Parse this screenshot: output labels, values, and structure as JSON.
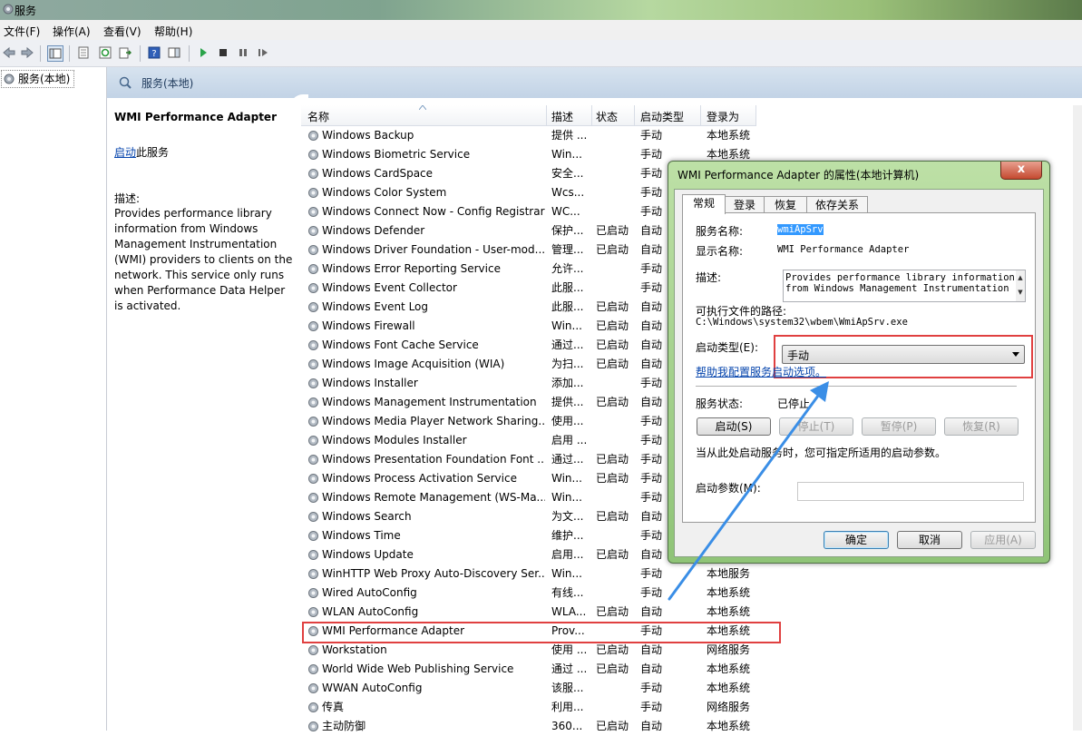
{
  "window": {
    "title": "服务"
  },
  "menu": [
    "文件(F)",
    "操作(A)",
    "查看(V)",
    "帮助(H)"
  ],
  "tree": {
    "root": "服务(本地)"
  },
  "panel_header": "服务(本地)",
  "details": {
    "service_name": "WMI Performance Adapter",
    "start_link": "启动",
    "start_suffix": "此服务",
    "desc_label": "描述:",
    "desc_text": "Provides performance library information from Windows Management Instrumentation (WMI) providers to clients on the network. This service only runs when Performance Data Helper is activated."
  },
  "columns": {
    "name": "名称",
    "desc": "描述",
    "status": "状态",
    "startup": "启动类型",
    "logon": "登录为"
  },
  "services": [
    {
      "name": "Windows Backup",
      "desc": "提供 ...",
      "status": "",
      "startup": "手动",
      "logon": "本地系统"
    },
    {
      "name": "Windows Biometric Service",
      "desc": "Win...",
      "status": "",
      "startup": "手动",
      "logon": "本地系统"
    },
    {
      "name": "Windows CardSpace",
      "desc": "安全...",
      "status": "",
      "startup": "手动",
      "logon": ""
    },
    {
      "name": "Windows Color System",
      "desc": "Wcs...",
      "status": "",
      "startup": "手动",
      "logon": ""
    },
    {
      "name": "Windows Connect Now - Config Registrar",
      "desc": "WC...",
      "status": "",
      "startup": "手动",
      "logon": ""
    },
    {
      "name": "Windows Defender",
      "desc": "保护...",
      "status": "已启动",
      "startup": "自动",
      "logon": ""
    },
    {
      "name": "Windows Driver Foundation - User-mod...",
      "desc": "管理...",
      "status": "已启动",
      "startup": "自动",
      "logon": ""
    },
    {
      "name": "Windows Error Reporting Service",
      "desc": "允许...",
      "status": "",
      "startup": "手动",
      "logon": ""
    },
    {
      "name": "Windows Event Collector",
      "desc": "此服...",
      "status": "",
      "startup": "手动",
      "logon": ""
    },
    {
      "name": "Windows Event Log",
      "desc": "此服...",
      "status": "已启动",
      "startup": "自动",
      "logon": ""
    },
    {
      "name": "Windows Firewall",
      "desc": "Win...",
      "status": "已启动",
      "startup": "自动",
      "logon": ""
    },
    {
      "name": "Windows Font Cache Service",
      "desc": "通过...",
      "status": "已启动",
      "startup": "自动",
      "logon": ""
    },
    {
      "name": "Windows Image Acquisition (WIA)",
      "desc": "为扫...",
      "status": "已启动",
      "startup": "自动",
      "logon": ""
    },
    {
      "name": "Windows Installer",
      "desc": "添加...",
      "status": "",
      "startup": "手动",
      "logon": ""
    },
    {
      "name": "Windows Management Instrumentation",
      "desc": "提供...",
      "status": "已启动",
      "startup": "自动",
      "logon": ""
    },
    {
      "name": "Windows Media Player Network Sharing...",
      "desc": "使用...",
      "status": "",
      "startup": "手动",
      "logon": ""
    },
    {
      "name": "Windows Modules Installer",
      "desc": "启用 ...",
      "status": "",
      "startup": "手动",
      "logon": ""
    },
    {
      "name": "Windows Presentation Foundation Font ...",
      "desc": "通过...",
      "status": "已启动",
      "startup": "手动",
      "logon": ""
    },
    {
      "name": "Windows Process Activation Service",
      "desc": "Win...",
      "status": "已启动",
      "startup": "手动",
      "logon": ""
    },
    {
      "name": "Windows Remote Management (WS-Ma...",
      "desc": "Win...",
      "status": "",
      "startup": "手动",
      "logon": ""
    },
    {
      "name": "Windows Search",
      "desc": "为文...",
      "status": "已启动",
      "startup": "自动",
      "logon": ""
    },
    {
      "name": "Windows Time",
      "desc": "维护...",
      "status": "",
      "startup": "手动",
      "logon": ""
    },
    {
      "name": "Windows Update",
      "desc": "启用...",
      "status": "已启动",
      "startup": "自动",
      "logon": ""
    },
    {
      "name": "WinHTTP Web Proxy Auto-Discovery Ser...",
      "desc": "Win...",
      "status": "",
      "startup": "手动",
      "logon": "本地服务"
    },
    {
      "name": "Wired AutoConfig",
      "desc": "有线...",
      "status": "",
      "startup": "手动",
      "logon": "本地系统"
    },
    {
      "name": "WLAN AutoConfig",
      "desc": "WLA...",
      "status": "已启动",
      "startup": "自动",
      "logon": "本地系统"
    },
    {
      "name": "WMI Performance Adapter",
      "desc": "Prov...",
      "status": "",
      "startup": "手动",
      "logon": "本地系统"
    },
    {
      "name": "Workstation",
      "desc": "使用 ...",
      "status": "已启动",
      "startup": "自动",
      "logon": "网络服务"
    },
    {
      "name": "World Wide Web Publishing Service",
      "desc": "通过 ...",
      "status": "已启动",
      "startup": "自动",
      "logon": "本地系统"
    },
    {
      "name": "WWAN AutoConfig",
      "desc": "该服...",
      "status": "",
      "startup": "手动",
      "logon": "本地系统"
    },
    {
      "name": "传真",
      "desc": "利用...",
      "status": "",
      "startup": "手动",
      "logon": "网络服务"
    },
    {
      "name": "主动防御",
      "desc": "360...",
      "status": "已启动",
      "startup": "自动",
      "logon": "本地系统"
    }
  ],
  "dialog": {
    "title": "WMI Performance Adapter 的属性(本地计算机)",
    "close": "x",
    "tabs": [
      "常规",
      "登录",
      "恢复",
      "依存关系"
    ],
    "svc_name_label": "服务名称:",
    "svc_name_value": "wmiApSrv",
    "display_name_label": "显示名称:",
    "display_name_value": "WMI Performance Adapter",
    "desc_label": "描述:",
    "desc_value_1": "Provides performance library information",
    "desc_value_2": "from Windows Management Instrumentation",
    "path_label": "可执行文件的路径:",
    "path_value": "C:\\Windows\\system32\\wbem\\WmiApSrv.exe",
    "startup_label": "启动类型(E):",
    "startup_value": "手动",
    "help_link": "帮助我配置服务启动选项。",
    "status_label": "服务状态:",
    "status_value": "已停止",
    "btn_start": "启动(S)",
    "btn_stop": "停止(T)",
    "btn_pause": "暂停(P)",
    "btn_resume": "恢复(R)",
    "hint": "当从此处启动服务时，您可指定所适用的启动参数。",
    "param_label": "启动参数(M):",
    "param_value": "",
    "ok": "确定",
    "cancel": "取消",
    "apply": "应用(A)"
  },
  "colors": {
    "highlight_red": "#e04040",
    "arrow_blue": "#3a8ee6",
    "link_blue": "#0645ad",
    "selection_blue": "#3399ff"
  }
}
